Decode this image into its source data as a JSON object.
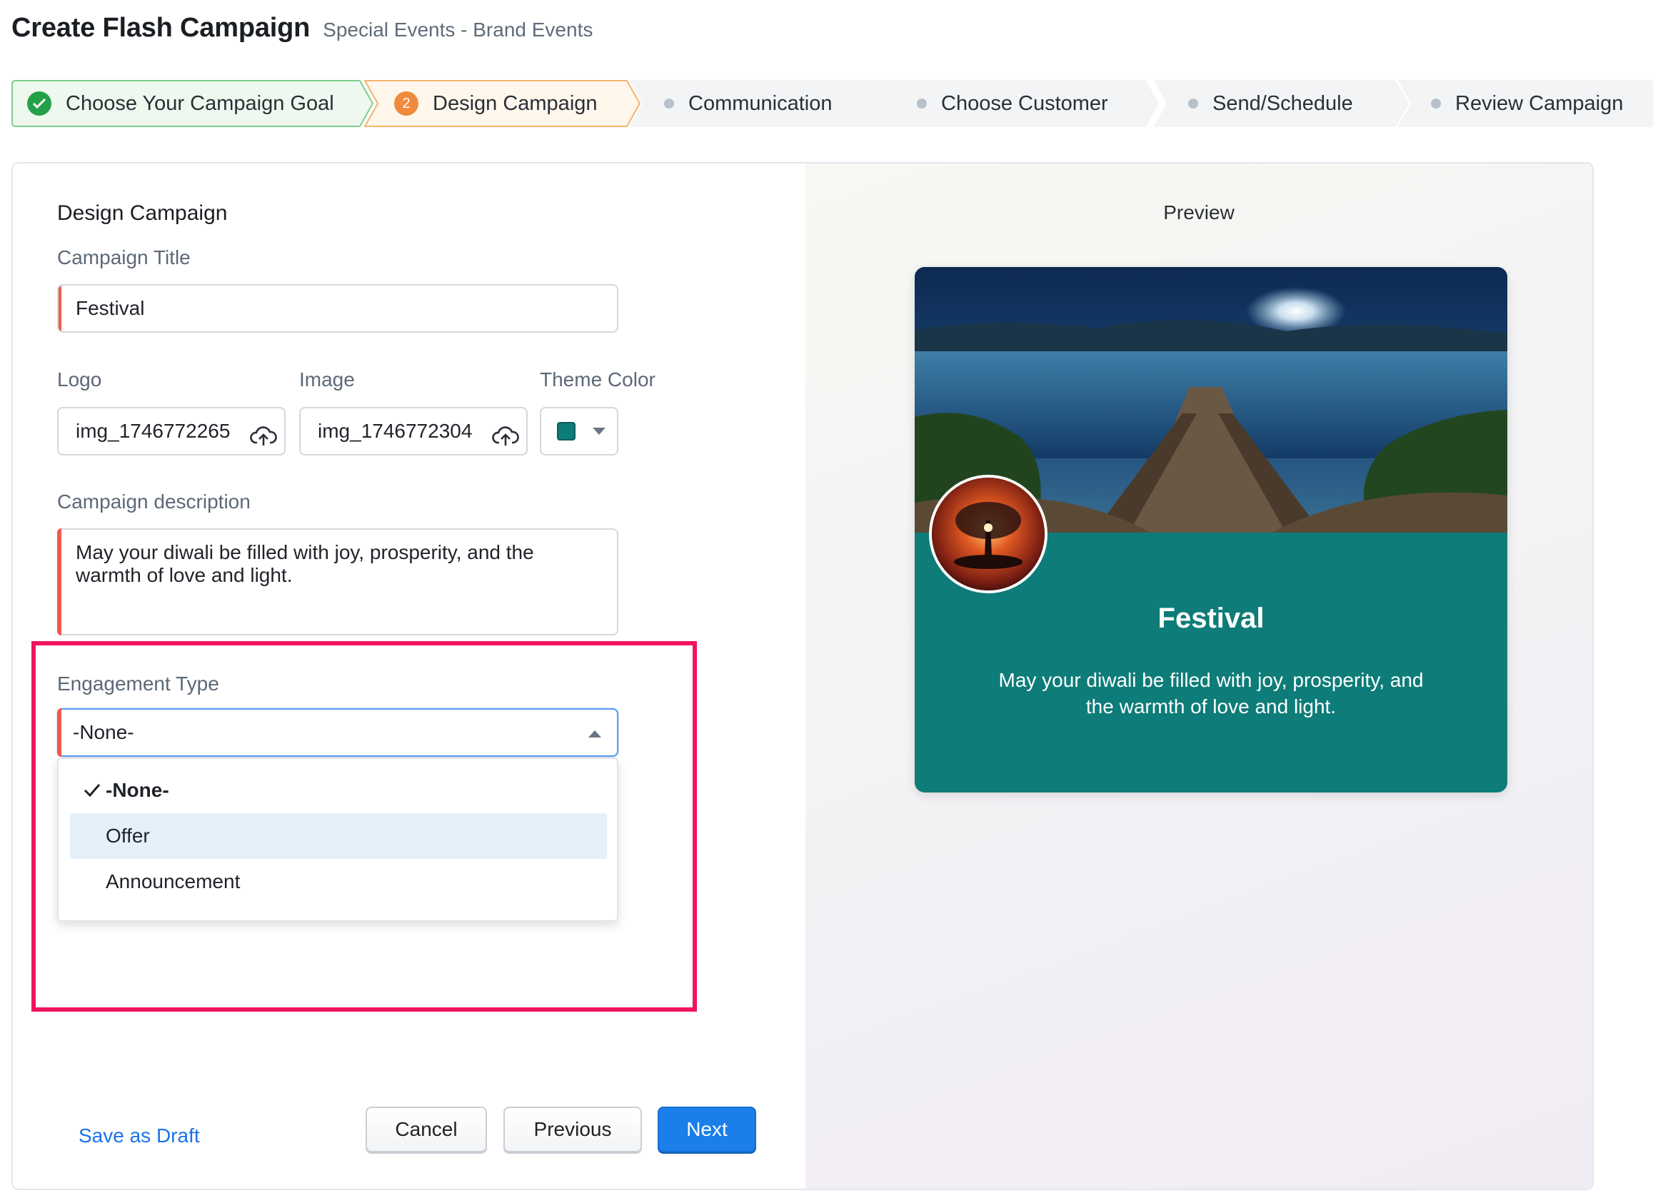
{
  "header": {
    "title": "Create Flash Campaign",
    "subtitle": "Special Events - Brand Events"
  },
  "stepper": {
    "steps": [
      {
        "label": "Choose Your Campaign Goal",
        "state": "completed"
      },
      {
        "label": "Design Campaign",
        "state": "current",
        "number": "2"
      },
      {
        "label": "Communication",
        "state": "upcoming"
      },
      {
        "label": "Choose Customer",
        "state": "upcoming"
      },
      {
        "label": "Send/Schedule",
        "state": "upcoming"
      },
      {
        "label": "Review Campaign",
        "state": "upcoming"
      }
    ]
  },
  "form": {
    "section_title": "Design Campaign",
    "campaign_title_label": "Campaign Title",
    "campaign_title_value": "Festival",
    "logo_label": "Logo",
    "logo_value": "img_1746772265",
    "image_label": "Image",
    "image_value": "img_1746772304",
    "theme_color_label": "Theme Color",
    "theme_color": "#0e7c78",
    "description_label": "Campaign description",
    "description_value": "May your diwali be filled with joy, prosperity, and the warmth of love and light.",
    "engagement_label": "Engagement Type",
    "engagement_value": "-None-",
    "engagement_options": [
      {
        "label": "-None-",
        "selected": true
      },
      {
        "label": "Offer",
        "selected": false
      },
      {
        "label": "Announcement",
        "selected": false
      }
    ]
  },
  "footer": {
    "save_draft": "Save as Draft",
    "cancel": "Cancel",
    "previous": "Previous",
    "next": "Next"
  },
  "preview": {
    "label": "Preview",
    "title": "Festival",
    "description": "May your diwali be filled with joy, prosperity, and the warmth of love and light."
  },
  "colors": {
    "accent_blue": "#1a7fe8",
    "required_red": "#ef5a4b",
    "highlight_pink": "#f0145c",
    "success_green": "#24a148",
    "current_orange": "#f08a3c"
  }
}
